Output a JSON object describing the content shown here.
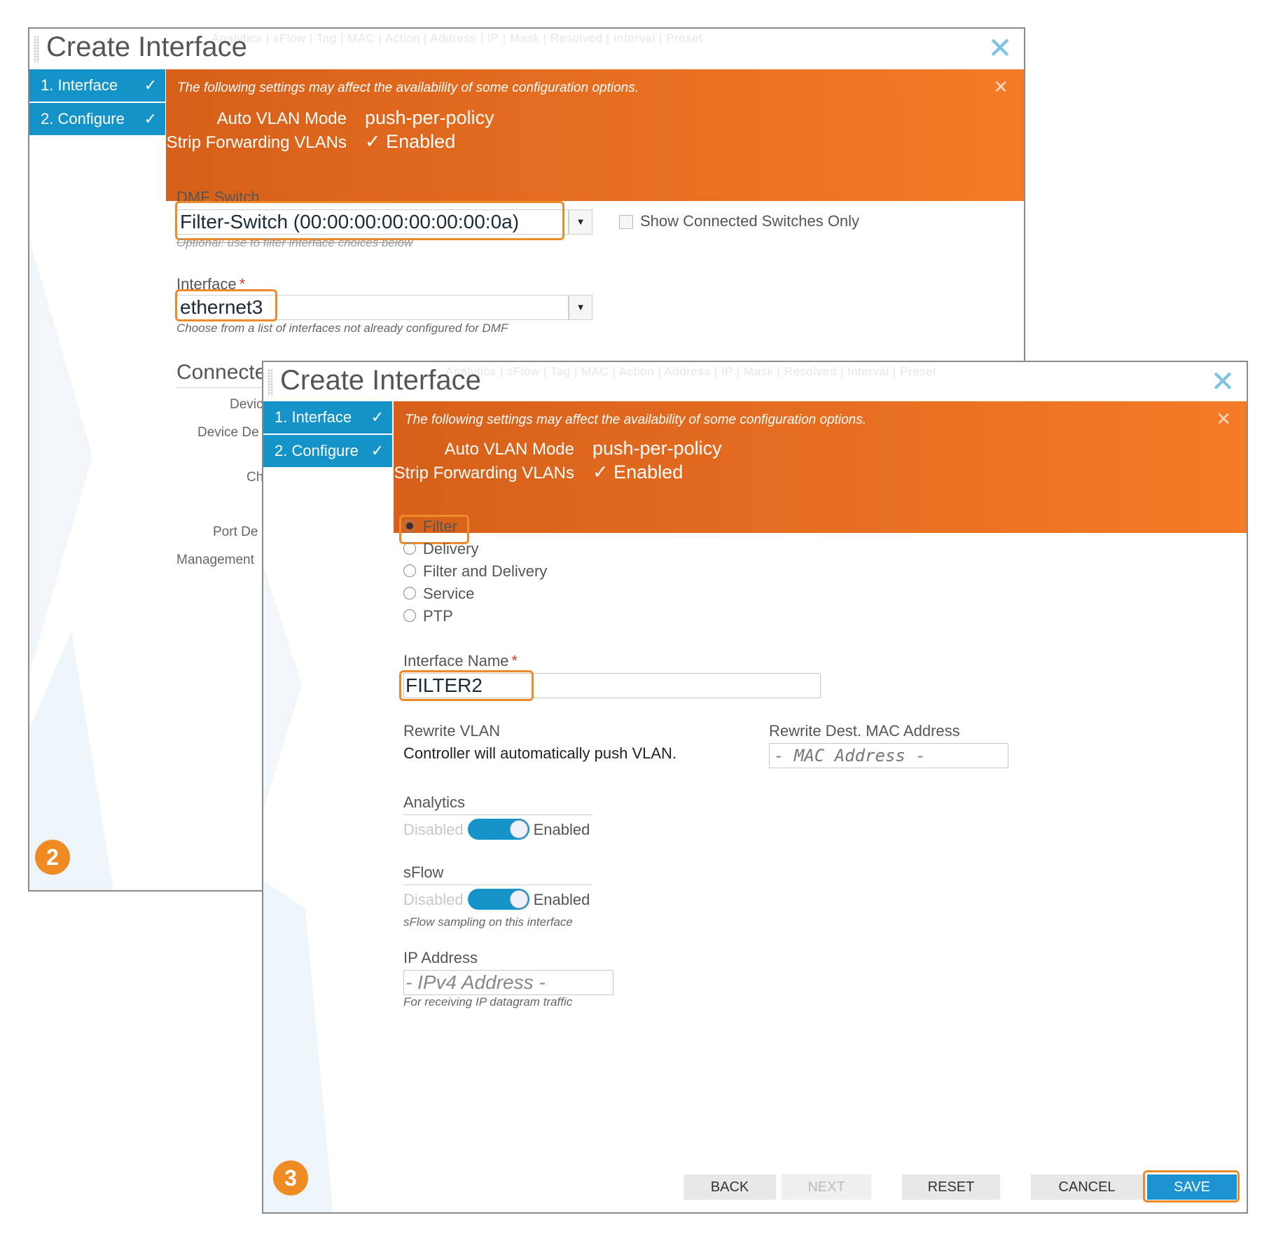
{
  "dialog2": {
    "title": "Create Interface",
    "ghost_header": "Analytics | sFlow | Tag | MAC | Action | Address | IP | Mask | Resolved | Interval | Preset",
    "steps": [
      {
        "label": "1. Interface",
        "check": "✓"
      },
      {
        "label": "2. Configure",
        "check": "✓"
      }
    ],
    "banner": {
      "message": "The following settings may affect the availability of some configuration options.",
      "rows": [
        {
          "label": "Auto VLAN Mode",
          "value": "push-per-policy"
        },
        {
          "label": "Strip Forwarding VLANs",
          "value": "✓ Enabled"
        }
      ]
    },
    "dmf_switch": {
      "label": "DMF Switch",
      "value": "Filter-Switch (00:00:00:00:00:00:00:0a)",
      "hint": "Optional: use to filter interface choices below",
      "show_connected_label": "Show Connected Switches Only"
    },
    "interface": {
      "label": "Interface",
      "value": "ethernet3",
      "hint": "Choose from a list of interfaces not already configured for DMF"
    },
    "connected_section": {
      "heading": "Connecte",
      "labels": [
        "Devic",
        "Device De",
        "Ch",
        "Port De",
        "Management"
      ]
    },
    "badge": "2"
  },
  "dialog3": {
    "title": "Create Interface",
    "ghost_header": "Analytics | sFlow | Tag | MAC | Action | Address | IP | Mask | Resolved | Interval | Preset",
    "steps": [
      {
        "label": "1. Interface",
        "check": "✓"
      },
      {
        "label": "2. Configure",
        "check": "✓"
      }
    ],
    "banner": {
      "message": "The following settings may affect the availability of some configuration options.",
      "rows": [
        {
          "label": "Auto VLAN Mode",
          "value": "push-per-policy"
        },
        {
          "label": "Strip Forwarding VLANs",
          "value": "✓ Enabled"
        }
      ]
    },
    "role_options": [
      {
        "label": "Filter",
        "selected": true
      },
      {
        "label": "Delivery",
        "selected": false
      },
      {
        "label": "Filter and Delivery",
        "selected": false
      },
      {
        "label": "Service",
        "selected": false
      },
      {
        "label": "PTP",
        "selected": false
      }
    ],
    "interface_name": {
      "label": "Interface Name",
      "value": "FILTER2"
    },
    "rewrite_vlan": {
      "label": "Rewrite VLAN",
      "text": "Controller will automatically push VLAN."
    },
    "rewrite_mac": {
      "label": "Rewrite Dest. MAC Address",
      "placeholder": "- MAC Address -"
    },
    "analytics": {
      "label": "Analytics",
      "off_label": "Disabled",
      "on_label": "Enabled",
      "state": "on"
    },
    "sflow": {
      "label": "sFlow",
      "off_label": "Disabled",
      "on_label": "Enabled",
      "state": "on",
      "hint": "sFlow sampling on this interface"
    },
    "ip_address": {
      "label": "IP Address",
      "placeholder": "- IPv4 Address -",
      "hint": "For receiving IP datagram traffic"
    },
    "buttons": {
      "back": "BACK",
      "next": "NEXT",
      "reset": "RESET",
      "cancel": "CANCEL",
      "save": "SAVE"
    },
    "badge": "3"
  },
  "colors": {
    "accent_blue": "#1493c9",
    "banner_orange": "#e8701f",
    "highlight_orange": "#ef8a2a",
    "badge_orange": "#f08a23"
  }
}
